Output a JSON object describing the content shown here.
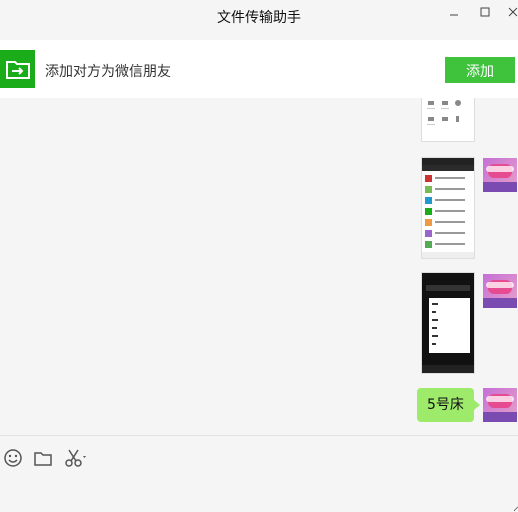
{
  "window": {
    "title": "文件传输助手",
    "controls": {
      "minimize": "—",
      "maximize": "☐",
      "close": "✕"
    }
  },
  "banner": {
    "text": "添加对方为微信朋友",
    "add_label": "添加"
  },
  "messages": [
    {
      "type": "image",
      "description": "screenshot thumbnail"
    },
    {
      "type": "image",
      "description": "screenshot thumbnail"
    },
    {
      "type": "image",
      "description": "screenshot thumbnail"
    },
    {
      "type": "text",
      "text": "5号床"
    }
  ],
  "toolbar": {
    "icons": [
      "emoji-icon",
      "folder-icon",
      "scissors-icon"
    ]
  },
  "colors": {
    "bubble": "#9eea6a",
    "add_button": "#3fc23c",
    "banner_icon": "#1aad19"
  }
}
